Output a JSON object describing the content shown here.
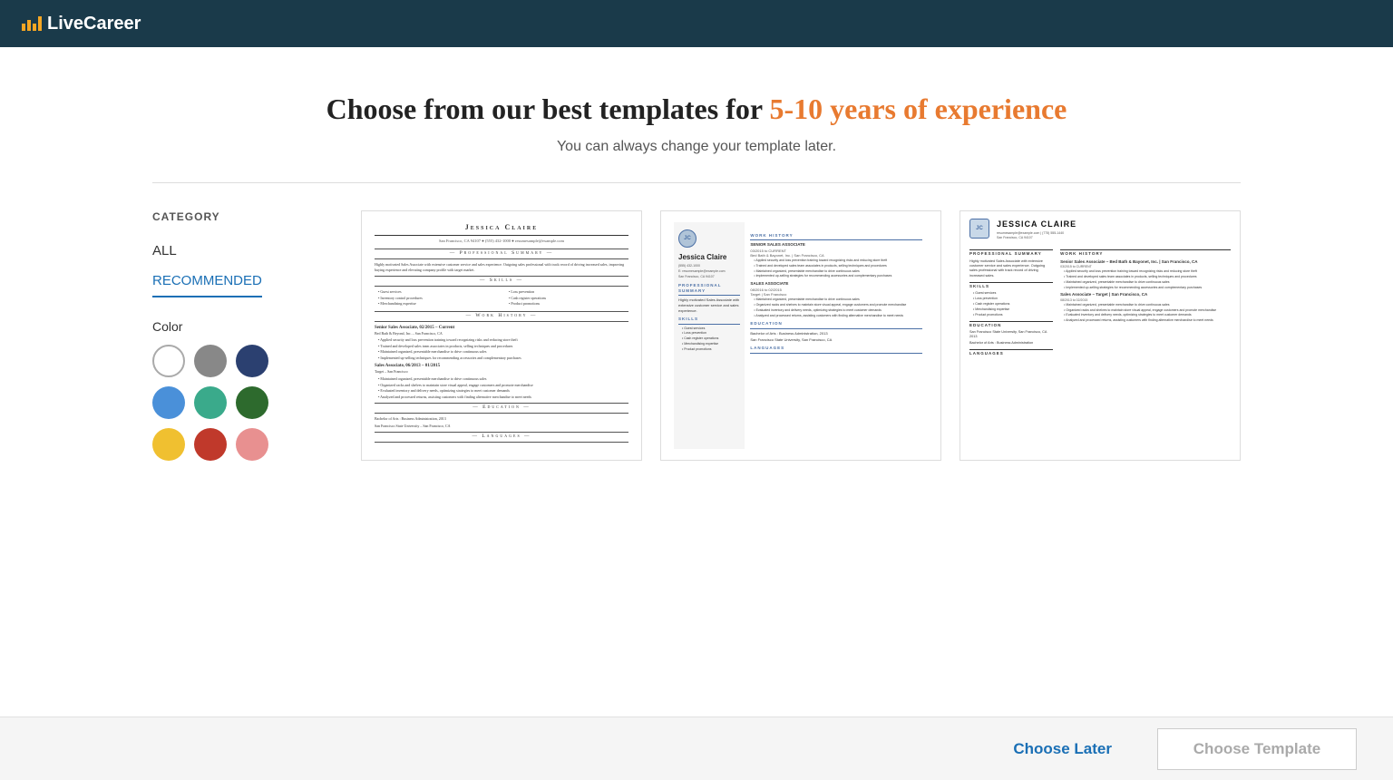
{
  "header": {
    "logo_text": "LiveCareer"
  },
  "page": {
    "headline_part1": "Choose from our best templates for ",
    "headline_accent": "5-10 years of experience",
    "subheadline": "You can always change your template later."
  },
  "sidebar": {
    "category_label": "CATEGORY",
    "items": [
      {
        "label": "ALL",
        "active": false
      },
      {
        "label": "RECOMMENDED",
        "active": true
      }
    ],
    "color_label": "Color",
    "colors": [
      {
        "name": "white",
        "hex": "#ffffff",
        "selected": true
      },
      {
        "name": "gray",
        "hex": "#888888"
      },
      {
        "name": "navy",
        "hex": "#2b4070"
      },
      {
        "name": "blue",
        "hex": "#4a90d9"
      },
      {
        "name": "teal",
        "hex": "#3aaa8b"
      },
      {
        "name": "dark-green",
        "hex": "#2d6a2d"
      },
      {
        "name": "yellow",
        "hex": "#f0c030"
      },
      {
        "name": "red",
        "hex": "#c0392b"
      },
      {
        "name": "pink",
        "hex": "#e89090"
      }
    ]
  },
  "templates": [
    {
      "id": "template-1",
      "name": "Classic",
      "person_name": "Jessica Claire",
      "contact": "San Francisco, CA 94107 • (555) 432-1000 • resumesample@example.com",
      "sections": [
        "Professional Summary",
        "Skills",
        "Work History",
        "Education",
        "Languages"
      ]
    },
    {
      "id": "template-2",
      "name": "Modern Left Sidebar",
      "person_name": "Jessica Claire",
      "initials": "JC",
      "contact_lines": [
        "(555) 432-1000 E: resumesample@example.com",
        "San Francisco, CA 94107"
      ],
      "sections": [
        "Professional Summary",
        "Skills",
        "Work History",
        "Education",
        "Languages"
      ]
    },
    {
      "id": "template-3",
      "name": "Two Column",
      "person_name": "JESSICA CLAIRE",
      "initials": "JC",
      "contact_lines": [
        "resumesample@example.com | (775) 555-1440",
        "San Francisco, CA 94107"
      ],
      "sections": [
        "Professional Summary",
        "Skills",
        "Work History",
        "Education",
        "Languages"
      ]
    }
  ],
  "footer": {
    "choose_later_label": "Choose Later",
    "choose_template_label": "Choose Template"
  }
}
